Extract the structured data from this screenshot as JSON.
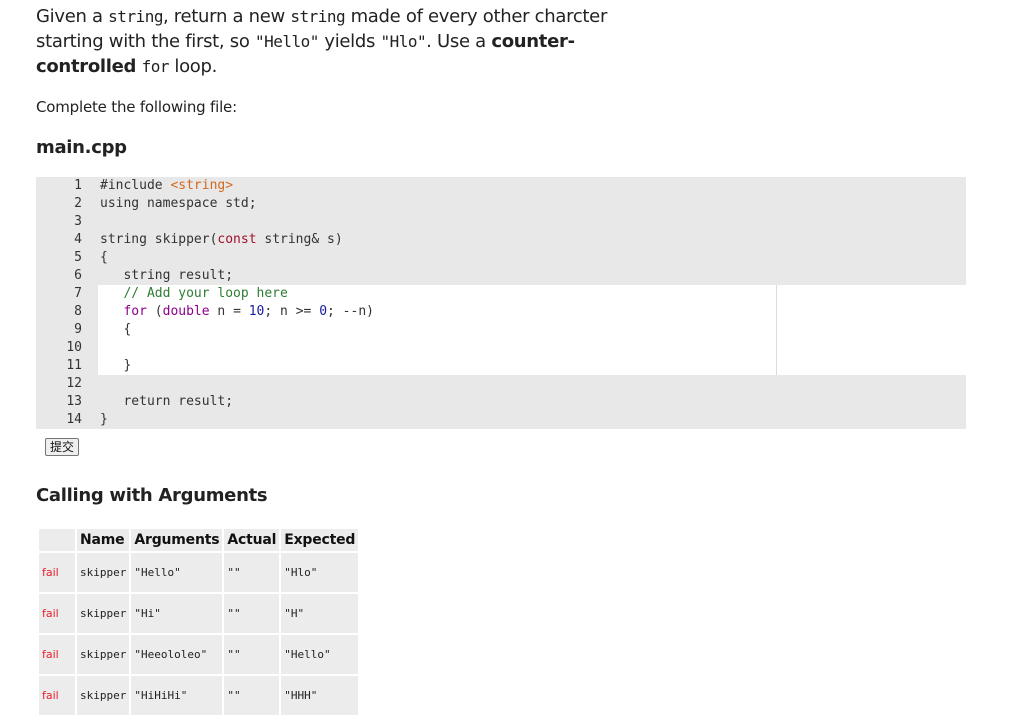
{
  "prompt": {
    "part1": "Given a ",
    "code1": "string",
    "part2": ", return a new ",
    "code2": "string",
    "part3": " made of every other charcter starting with the first, so ",
    "code3": "\"Hello\"",
    "part4": " yields ",
    "code4": "\"Hlo\"",
    "part5": ". Use a ",
    "bold1": "counter-controlled",
    "part6": " ",
    "code5": "for",
    "part7": " loop."
  },
  "instructions": "Complete the following file:",
  "file": {
    "name": "main.cpp",
    "lines": [
      {
        "num": "1",
        "tokens": [
          {
            "t": "#include ",
            "c": "kw-inc"
          },
          {
            "t": "<string>",
            "c": "str"
          }
        ]
      },
      {
        "num": "2",
        "tokens": [
          {
            "t": "using namespace std;",
            "c": ""
          }
        ]
      },
      {
        "num": "3",
        "tokens": []
      },
      {
        "num": "4",
        "tokens": [
          {
            "t": "string skipper(",
            "c": ""
          },
          {
            "t": "const",
            "c": "kw"
          },
          {
            "t": " string& s)",
            "c": ""
          }
        ]
      },
      {
        "num": "5",
        "tokens": [
          {
            "t": "{",
            "c": ""
          }
        ]
      },
      {
        "num": "6",
        "tokens": [
          {
            "t": "   string result;",
            "c": ""
          }
        ]
      },
      {
        "num": "7",
        "tokens": [
          {
            "t": "   // Add your loop here",
            "c": "cm"
          }
        ]
      },
      {
        "num": "8",
        "tokens": [
          {
            "t": "   ",
            "c": ""
          },
          {
            "t": "for",
            "c": "kw2"
          },
          {
            "t": " (",
            "c": ""
          },
          {
            "t": "double",
            "c": "kw2"
          },
          {
            "t": " n = ",
            "c": ""
          },
          {
            "t": "10",
            "c": "num"
          },
          {
            "t": "; n >= ",
            "c": ""
          },
          {
            "t": "0",
            "c": "num"
          },
          {
            "t": "; --n)",
            "c": ""
          }
        ]
      },
      {
        "num": "9",
        "tokens": [
          {
            "t": "   {",
            "c": ""
          }
        ]
      },
      {
        "num": "10",
        "tokens": []
      },
      {
        "num": "11",
        "tokens": [
          {
            "t": "   }",
            "c": ""
          }
        ]
      },
      {
        "num": "12",
        "tokens": []
      },
      {
        "num": "13",
        "tokens": [
          {
            "t": "   return result;",
            "c": ""
          }
        ]
      },
      {
        "num": "14",
        "tokens": [
          {
            "t": "}",
            "c": ""
          }
        ]
      }
    ],
    "editable_lines": [
      7,
      11
    ]
  },
  "submit_label": "提交",
  "results": {
    "title": "Calling with Arguments",
    "headers": [
      "",
      "Name",
      "Arguments",
      "Actual",
      "Expected"
    ],
    "rows": [
      {
        "status": "fail",
        "name": "skipper",
        "args": "\"Hello\"",
        "actual": "\"\"",
        "expected": "\"Hlo\""
      },
      {
        "status": "fail",
        "name": "skipper",
        "args": "\"Hi\"",
        "actual": "\"\"",
        "expected": "\"H\""
      },
      {
        "status": "fail",
        "name": "skipper",
        "args": "\"Heeololeo\"",
        "actual": "\"\"",
        "expected": "\"Hello\""
      },
      {
        "status": "fail",
        "name": "skipper",
        "args": "\"HiHiHi\"",
        "actual": "\"\"",
        "expected": "\"HHH\""
      }
    ]
  },
  "colors": {
    "fail": "#e8202a",
    "editor_bg": "#e8e8e8",
    "editable_bg": "#ffffff"
  }
}
